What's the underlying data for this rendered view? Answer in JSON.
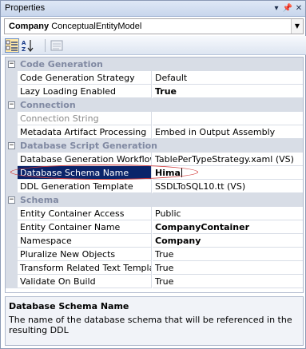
{
  "window": {
    "title": "Properties"
  },
  "selector": {
    "object_name": "Company",
    "object_type": "ConceptualEntityModel"
  },
  "categories": [
    {
      "name": "Code Generation",
      "properties": [
        {
          "name": "Code Generation Strategy",
          "value": "Default",
          "bold": false,
          "disabled": false
        },
        {
          "name": "Lazy Loading Enabled",
          "value": "True",
          "bold": true,
          "disabled": false
        }
      ]
    },
    {
      "name": "Connection",
      "properties": [
        {
          "name": "Connection String",
          "value": "",
          "bold": false,
          "disabled": true
        },
        {
          "name": "Metadata Artifact Processing",
          "value": "Embed in Output Assembly",
          "bold": false,
          "disabled": false
        }
      ]
    },
    {
      "name": "Database Script Generation",
      "properties": [
        {
          "name": "Database Generation Workflow",
          "value": "TablePerTypeStrategy.xaml (VS)",
          "bold": false,
          "disabled": false
        },
        {
          "name": "Database Schema Name",
          "value": "Hima",
          "bold": true,
          "disabled": false,
          "selected": true
        },
        {
          "name": "DDL Generation Template",
          "value": "SSDLToSQL10.tt (VS)",
          "bold": false,
          "disabled": false
        }
      ]
    },
    {
      "name": "Schema",
      "properties": [
        {
          "name": "Entity Container Access",
          "value": "Public",
          "bold": false,
          "disabled": false
        },
        {
          "name": "Entity Container Name",
          "value": "CompanyContainer",
          "bold": true,
          "disabled": false
        },
        {
          "name": "Namespace",
          "value": "Company",
          "bold": true,
          "disabled": false
        },
        {
          "name": "Pluralize New Objects",
          "value": "True",
          "bold": false,
          "disabled": false
        },
        {
          "name": "Transform Related Text Templates",
          "value": "True",
          "bold": false,
          "disabled": false
        },
        {
          "name": "Validate On Build",
          "value": "True",
          "bold": false,
          "disabled": false
        }
      ]
    }
  ],
  "description": {
    "title": "Database Schema Name",
    "text": "The name of the database schema that will be referenced in the resulting DDL"
  },
  "colors": {
    "selection": "#0a246a",
    "category_band": "#d8dde6",
    "annotation": "#d23b3b"
  }
}
